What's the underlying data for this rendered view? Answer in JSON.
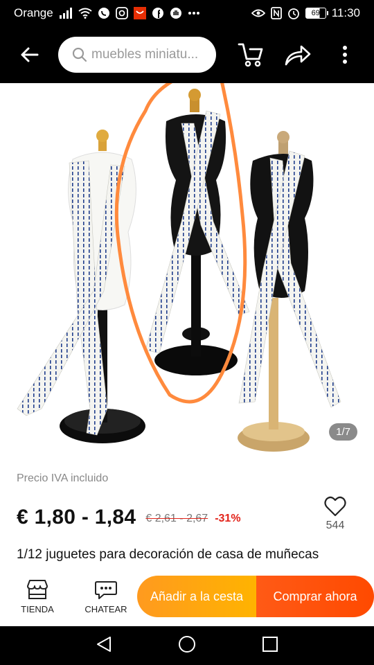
{
  "status_bar": {
    "carrier": "Orange",
    "battery_level": "69",
    "time": "11:30"
  },
  "top_nav": {
    "search_placeholder": "muebles miniatu..."
  },
  "gallery": {
    "counter": "1/7"
  },
  "product": {
    "tax_note": "Precio IVA incluido",
    "price": "€ 1,80 - 1,84",
    "old_price": "€ 2,61 - 2,67",
    "discount": "-31%",
    "wishlist_count": "544",
    "title": "1/12 juguetes para decoración de casa de muñecas"
  },
  "action_bar": {
    "store_label": "TIENDA",
    "chat_label": "CHATEAR",
    "add_to_cart_label": "Añadir a la cesta",
    "buy_now_label": "Comprar ahora"
  },
  "colors": {
    "accent_orange": "#ffa41c",
    "accent_red_orange": "#ff4a00",
    "discount_red": "#e2231a",
    "annotation_circle": "#ff8a3d"
  }
}
